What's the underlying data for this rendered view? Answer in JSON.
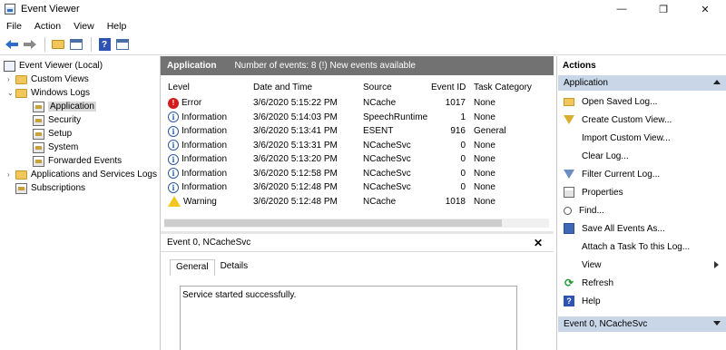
{
  "window": {
    "title": "Event Viewer",
    "controls": {
      "minimize": "—",
      "restore": "❐",
      "close": "✕"
    }
  },
  "menu": [
    "File",
    "Action",
    "View",
    "Help"
  ],
  "toolbar": {
    "icons": [
      "back-icon",
      "forward-icon",
      "folder-up-icon",
      "console-tree-icon",
      "help-icon",
      "action-pane-icon"
    ]
  },
  "tree": {
    "root": "Event Viewer (Local)",
    "custom_views": "Custom Views",
    "windows_logs": "Windows Logs",
    "application": "Application",
    "security": "Security",
    "setup": "Setup",
    "system": "System",
    "forwarded": "Forwarded Events",
    "app_services": "Applications and Services Logs",
    "subscriptions": "Subscriptions"
  },
  "center": {
    "log_name": "Application",
    "summary": "Number of events: 8 (!) New events available",
    "columns": [
      "Level",
      "Date and Time",
      "Source",
      "Event ID",
      "Task Category"
    ],
    "events": [
      {
        "level": "Error",
        "type": "error",
        "date": "3/6/2020 5:15:22 PM",
        "source": "NCache",
        "id": "1017",
        "category": "None"
      },
      {
        "level": "Information",
        "type": "info",
        "date": "3/6/2020 5:14:03 PM",
        "source": "SpeechRuntime",
        "id": "1",
        "category": "None"
      },
      {
        "level": "Information",
        "type": "info",
        "date": "3/6/2020 5:13:41 PM",
        "source": "ESENT",
        "id": "916",
        "category": "General"
      },
      {
        "level": "Information",
        "type": "info",
        "date": "3/6/2020 5:13:31 PM",
        "source": "NCacheSvc",
        "id": "0",
        "category": "None"
      },
      {
        "level": "Information",
        "type": "info",
        "date": "3/6/2020 5:13:20 PM",
        "source": "NCacheSvc",
        "id": "0",
        "category": "None"
      },
      {
        "level": "Information",
        "type": "info",
        "date": "3/6/2020 5:12:58 PM",
        "source": "NCacheSvc",
        "id": "0",
        "category": "None"
      },
      {
        "level": "Information",
        "type": "info",
        "date": "3/6/2020 5:12:48 PM",
        "source": "NCacheSvc",
        "id": "0",
        "category": "None"
      },
      {
        "level": "Warning",
        "type": "warn",
        "date": "3/6/2020 5:12:48 PM",
        "source": "NCache",
        "id": "1018",
        "category": "None"
      }
    ]
  },
  "detail": {
    "title": "Event 0, NCacheSvc",
    "close": "✕",
    "tabs": [
      "General",
      "Details"
    ],
    "message": "Service started successfully."
  },
  "actions": {
    "title": "Actions",
    "group1": "Application",
    "items": [
      {
        "label": "Open Saved Log...",
        "icon": "folder-icon"
      },
      {
        "label": "Create Custom View...",
        "icon": "filter-icon"
      },
      {
        "label": "Import Custom View...",
        "icon": ""
      },
      {
        "label": "Clear Log...",
        "icon": ""
      },
      {
        "label": "Filter Current Log...",
        "icon": "filter-icon"
      },
      {
        "label": "Properties",
        "icon": "properties-icon"
      },
      {
        "label": "Find...",
        "icon": "find-icon"
      },
      {
        "label": "Save All Events As...",
        "icon": "save-icon"
      },
      {
        "label": "Attach a Task To this Log...",
        "icon": ""
      },
      {
        "label": "View",
        "icon": ""
      },
      {
        "label": "Refresh",
        "icon": "refresh-icon"
      },
      {
        "label": "Help",
        "icon": "help-icon"
      }
    ],
    "group2": "Event 0, NCacheSvc"
  },
  "colors": {
    "header_bg": "#727272",
    "actions_group_bg": "#c8d6e8",
    "error": "#d41c1c",
    "info": "#2d5aa6",
    "warning": "#f2c81b"
  }
}
